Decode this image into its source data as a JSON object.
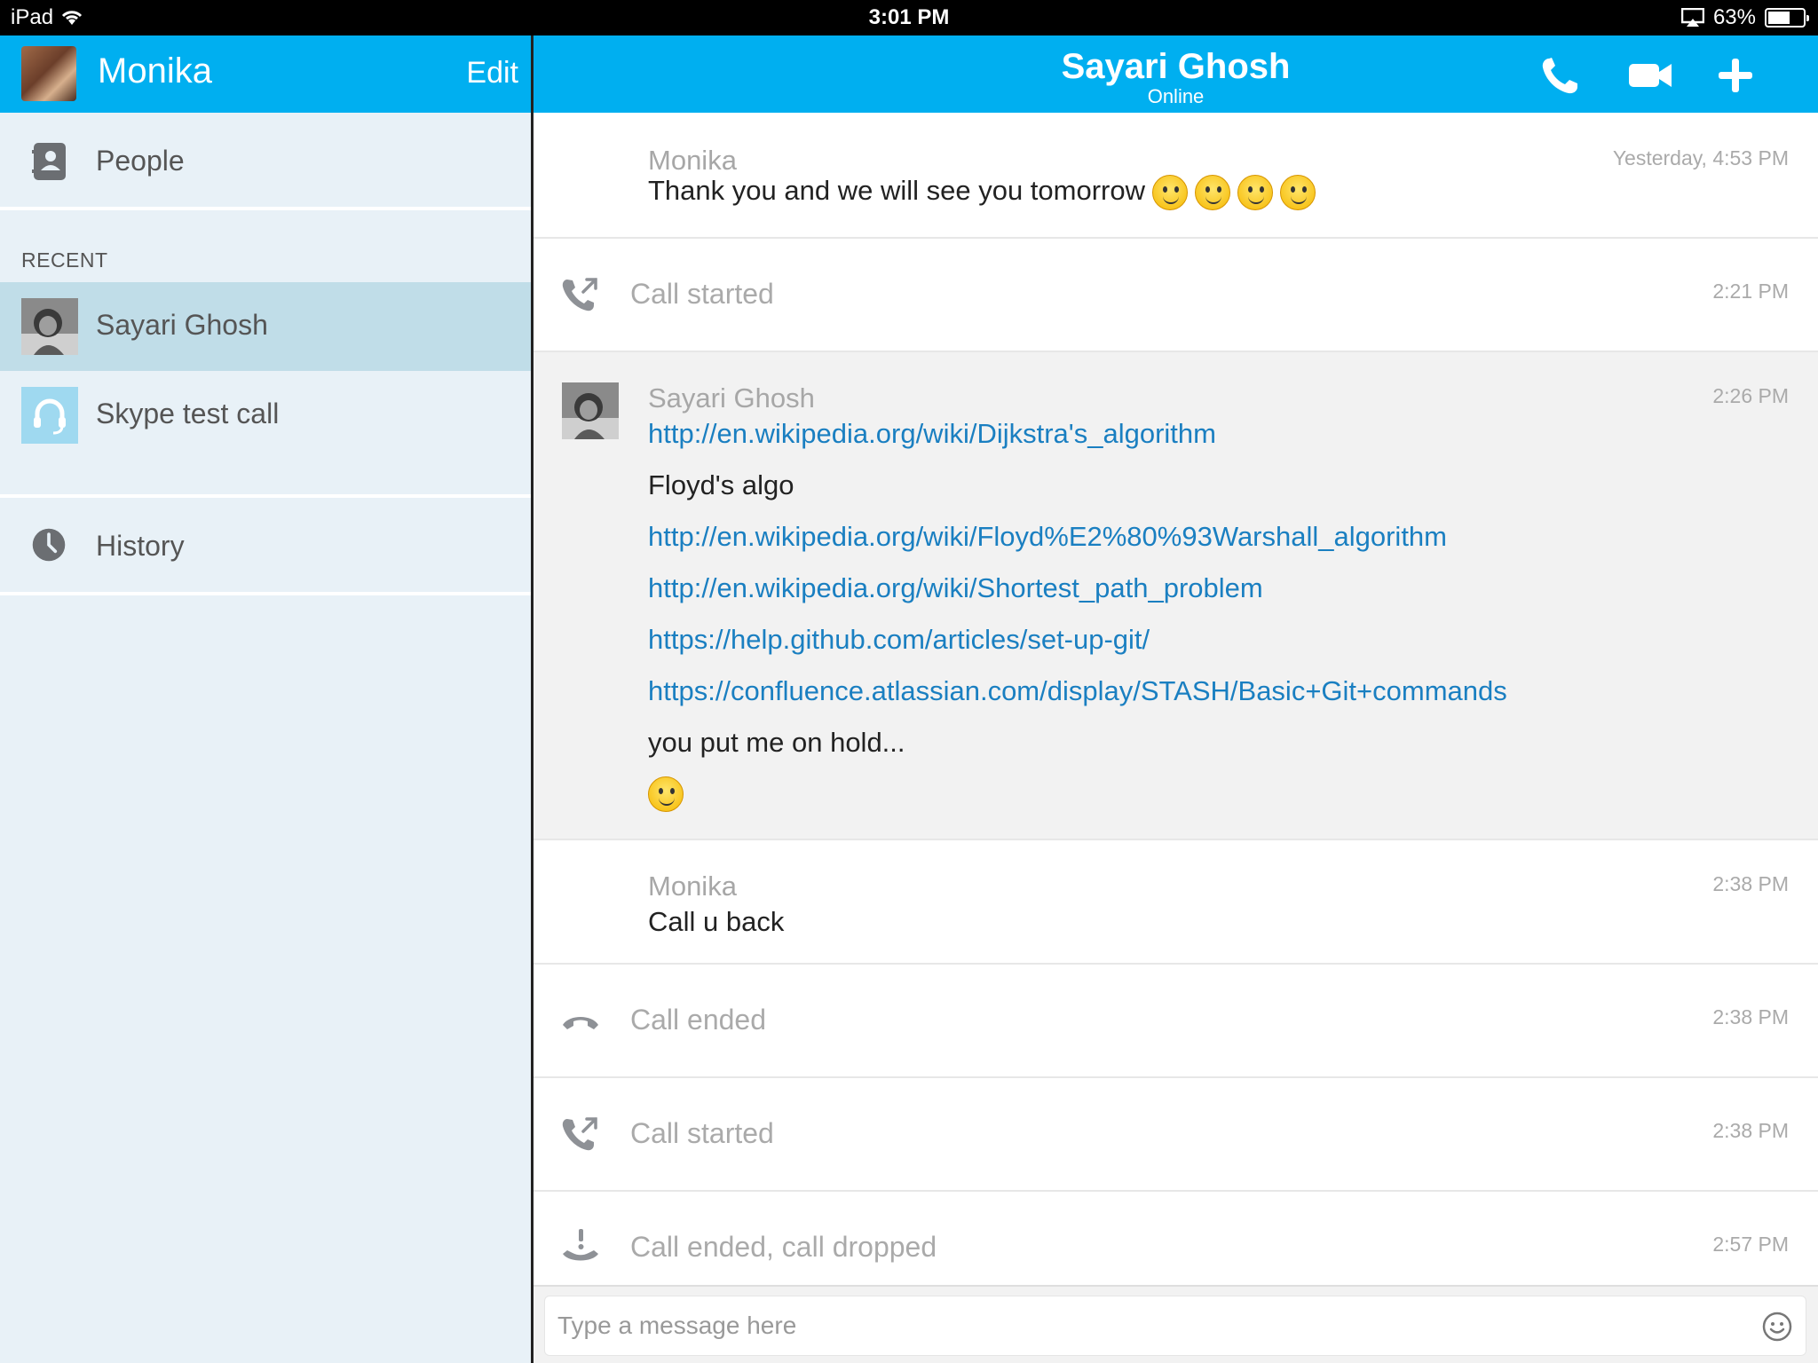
{
  "status_bar": {
    "device": "iPad",
    "time": "3:01 PM",
    "battery_percent": "63%",
    "battery_level": 0.63
  },
  "sidebar": {
    "user_name": "Monika",
    "edit_label": "Edit",
    "people_label": "People",
    "recent_heading": "RECENT",
    "recent_items": [
      {
        "label": "Sayari Ghosh",
        "selected": true
      },
      {
        "label": "Skype test call",
        "selected": false
      }
    ],
    "history_label": "History"
  },
  "chat": {
    "contact_name": "Sayari Ghosh",
    "contact_status": "Online",
    "actions": [
      "phone-icon",
      "video-camera-icon",
      "plus-icon"
    ],
    "messages": [
      {
        "kind": "message",
        "sender": "Monika",
        "time": "Yesterday, 4:53 PM",
        "text": "Thank you and we will see you tomorrow",
        "emoji_count": 4
      },
      {
        "kind": "call",
        "icon": "call-started-icon",
        "text": "Call started",
        "time": "2:21 PM"
      },
      {
        "kind": "message",
        "sender": "Sayari Ghosh",
        "time": "2:26 PM",
        "lines": [
          {
            "type": "link",
            "text": "http://en.wikipedia.org/wiki/Dijkstra's_algorithm"
          },
          {
            "type": "text",
            "text": "Floyd's algo"
          },
          {
            "type": "link",
            "text": "http://en.wikipedia.org/wiki/Floyd%E2%80%93Warshall_algorithm"
          },
          {
            "type": "link",
            "text": "http://en.wikipedia.org/wiki/Shortest_path_problem"
          },
          {
            "type": "link",
            "text": "https://help.github.com/articles/set-up-git/"
          },
          {
            "type": "link",
            "text": "https://confluence.atlassian.com/display/STASH/Basic+Git+commands"
          },
          {
            "type": "text",
            "text": "you put me on hold..."
          }
        ]
      },
      {
        "kind": "message",
        "sender": "Monika",
        "time": "2:38 PM",
        "text": "Call u back"
      },
      {
        "kind": "call",
        "icon": "call-ended-icon",
        "text": "Call ended",
        "time": "2:38 PM"
      },
      {
        "kind": "call",
        "icon": "call-started-icon",
        "text": "Call started",
        "time": "2:38 PM"
      },
      {
        "kind": "call",
        "icon": "call-dropped-icon",
        "text": "Call ended, call dropped",
        "time": "2:57 PM"
      }
    ],
    "composer_placeholder": "Type a message here"
  },
  "colors": {
    "accent": "#00aff0",
    "sidebar_bg": "#e8f1f7",
    "selected_bg": "#c0dde8",
    "link": "#1a7fc1",
    "highlighted_message_bg": "#f2f2f2"
  }
}
